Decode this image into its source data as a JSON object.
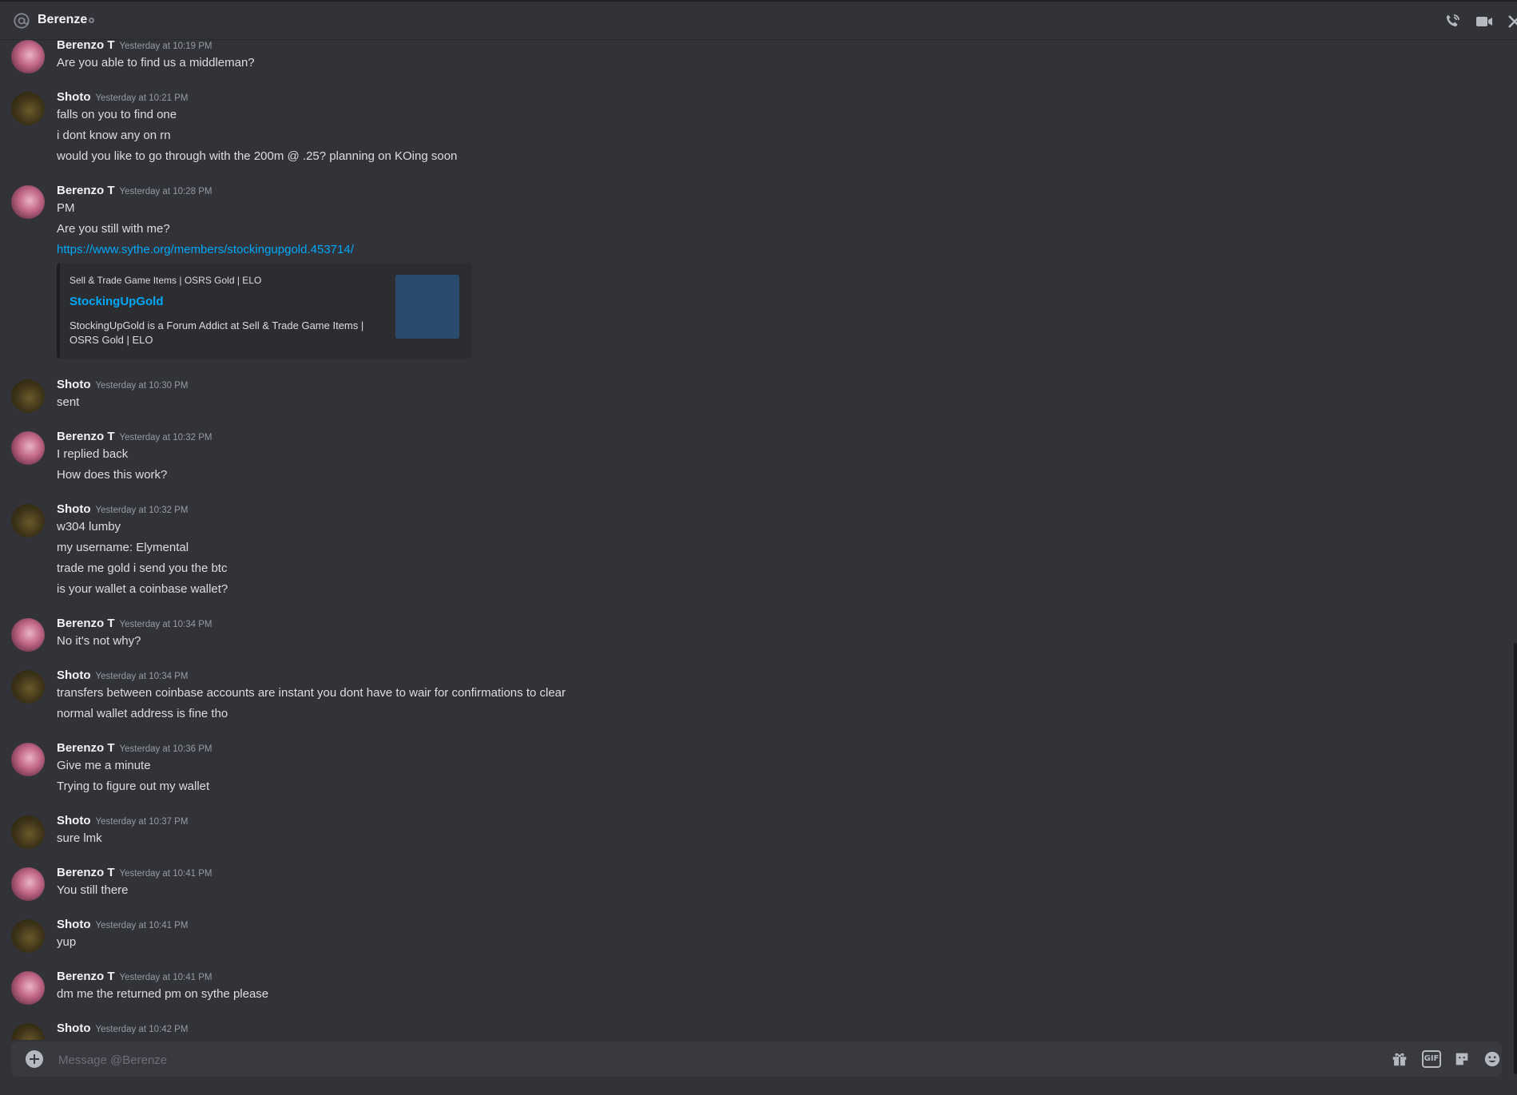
{
  "header": {
    "dm_name": "Berenze"
  },
  "composer": {
    "placeholder": "Message @Berenze"
  },
  "users": {
    "berenzo": "Berenzo T",
    "shoto": "Shoto"
  },
  "messages": [
    {
      "author": "Berenzo T",
      "time": "Yesterday at 10:19 PM",
      "lines": [
        "Are you able to find us a middleman?"
      ]
    },
    {
      "author": "Shoto",
      "time": "Yesterday at 10:21 PM",
      "lines": [
        "falls on you to find one",
        "i dont know any on rn",
        "would you like to go through with the 200m @ .25? planning on KOing soon"
      ]
    },
    {
      "author": "Berenzo T",
      "time": "Yesterday at 10:28 PM",
      "lines": [
        "PM",
        "Are you still with me?",
        "https://www.sythe.org/members/stockingupgold.453714/"
      ],
      "embed": {
        "provider": "Sell & Trade Game Items | OSRS Gold | ELO",
        "title": "StockingUpGold",
        "description": "StockingUpGold is a Forum Addict at Sell & Trade Game Items | OSRS Gold | ELO"
      }
    },
    {
      "author": "Shoto",
      "time": "Yesterday at 10:30 PM",
      "lines": [
        "sent"
      ]
    },
    {
      "author": "Berenzo T",
      "time": "Yesterday at 10:32 PM",
      "lines": [
        "I replied back",
        "How does this work?"
      ]
    },
    {
      "author": "Shoto",
      "time": "Yesterday at 10:32 PM",
      "lines": [
        "w304 lumby",
        "my username: Elymental",
        "trade me gold i send you the btc",
        "is your wallet a coinbase wallet?"
      ]
    },
    {
      "author": "Berenzo T",
      "time": "Yesterday at 10:34 PM",
      "lines": [
        "No it's not why?"
      ]
    },
    {
      "author": "Shoto",
      "time": "Yesterday at 10:34 PM",
      "lines": [
        "transfers between coinbase accounts are instant you dont have to wair for confirmations to clear",
        "normal wallet address is fine tho"
      ]
    },
    {
      "author": "Berenzo T",
      "time": "Yesterday at 10:36 PM",
      "lines": [
        "Give me a minute",
        "Trying to figure out my wallet"
      ]
    },
    {
      "author": "Shoto",
      "time": "Yesterday at 10:37 PM",
      "lines": [
        "sure lmk"
      ]
    },
    {
      "author": "Berenzo T",
      "time": "Yesterday at 10:41 PM",
      "lines": [
        "You still there"
      ]
    },
    {
      "author": "Shoto",
      "time": "Yesterday at 10:41 PM",
      "lines": [
        "yup"
      ]
    },
    {
      "author": "Berenzo T",
      "time": "Yesterday at 10:41 PM",
      "lines": [
        "dm me the returned pm on sythe please"
      ]
    },
    {
      "author": "Shoto",
      "time": "Yesterday at 10:42 PM",
      "lines": []
    }
  ],
  "icons": [
    "at-icon",
    "voice-call-icon",
    "video-call-icon",
    "close-icon",
    "add-attachment-icon",
    "gift-icon",
    "gif-icon",
    "sticker-icon",
    "emoji-icon"
  ],
  "colors": {
    "background": "#313338",
    "link": "#00a8fc",
    "composer": "#383a40"
  }
}
